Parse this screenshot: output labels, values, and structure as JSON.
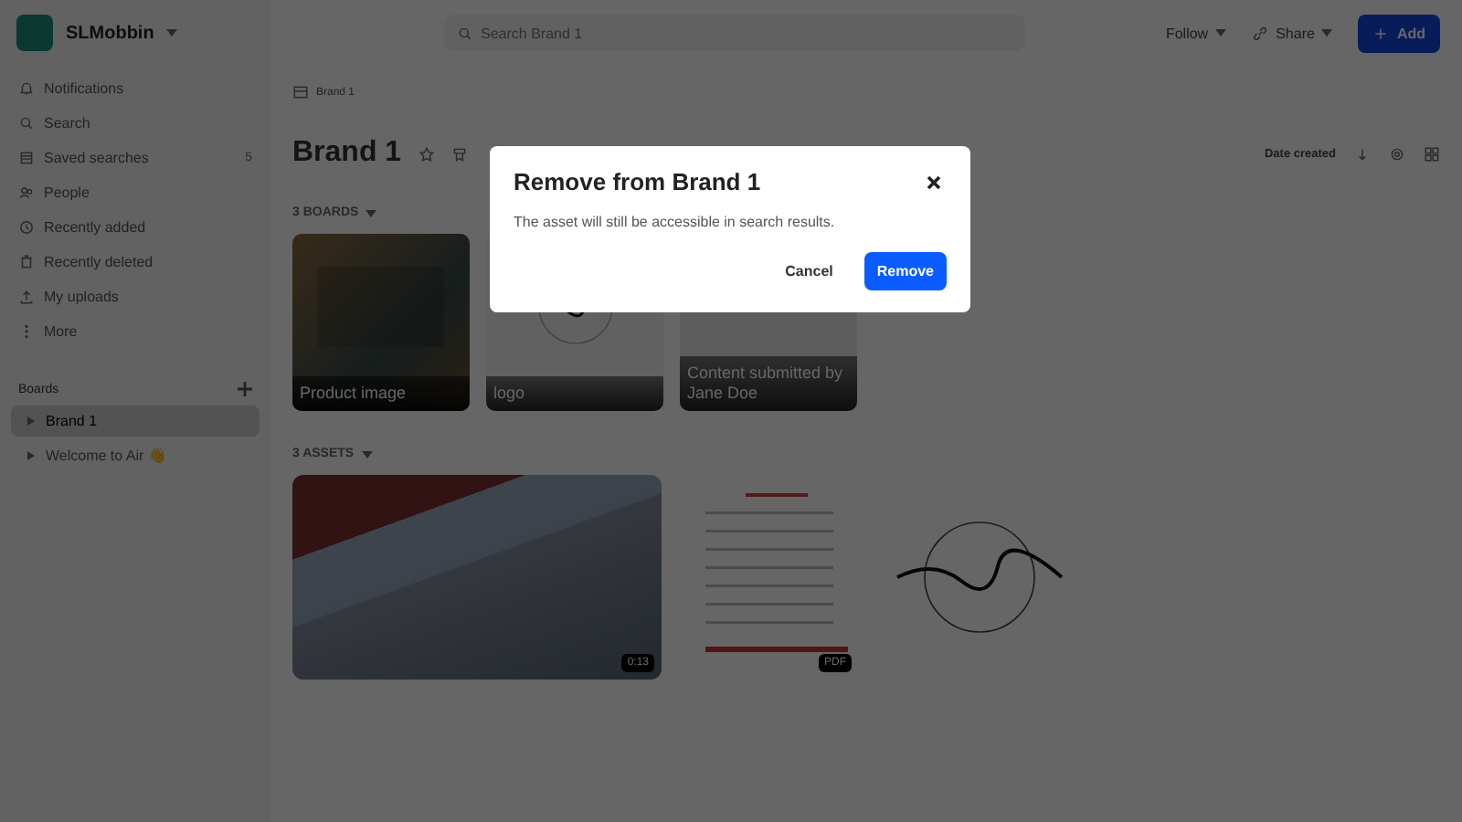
{
  "workspace": {
    "name": "SLMobbin"
  },
  "search": {
    "placeholder": "Search Brand 1"
  },
  "header_actions": {
    "follow": "Follow",
    "share": "Share",
    "add": "Add"
  },
  "sidebar": {
    "items": [
      {
        "kind": "bell",
        "label": "Notifications"
      },
      {
        "kind": "search",
        "label": "Search"
      },
      {
        "kind": "list",
        "label": "Saved searches",
        "count": "5"
      },
      {
        "kind": "people",
        "label": "People"
      },
      {
        "kind": "clock",
        "label": "Recently added"
      },
      {
        "kind": "trash",
        "label": "Recently deleted"
      },
      {
        "kind": "upload",
        "label": "My uploads"
      },
      {
        "kind": "more",
        "label": "More"
      }
    ],
    "boards_heading": "Boards",
    "boards": [
      {
        "label": "Brand 1",
        "selected": true
      },
      {
        "label": "Welcome to Air 👋",
        "selected": false
      }
    ]
  },
  "breadcrumb": "Brand 1",
  "title": "Brand 1",
  "sort": "Date created",
  "boards_section": {
    "heading": "3 BOARDS",
    "items": [
      {
        "kind": "photo",
        "label": "Product image"
      },
      {
        "kind": "logo",
        "label": "logo"
      },
      {
        "kind": "banner",
        "label": "Content submitted by Jane Doe"
      }
    ]
  },
  "assets_section": {
    "heading": "3 ASSETS",
    "items": [
      {
        "kind": "video",
        "badge": "0:13"
      },
      {
        "kind": "pdf",
        "badge": "PDF"
      },
      {
        "kind": "logo"
      }
    ]
  },
  "dialog": {
    "title": "Remove from Brand 1",
    "message": "The asset will still be accessible in search results.",
    "cancel": "Cancel",
    "confirm": "Remove"
  }
}
